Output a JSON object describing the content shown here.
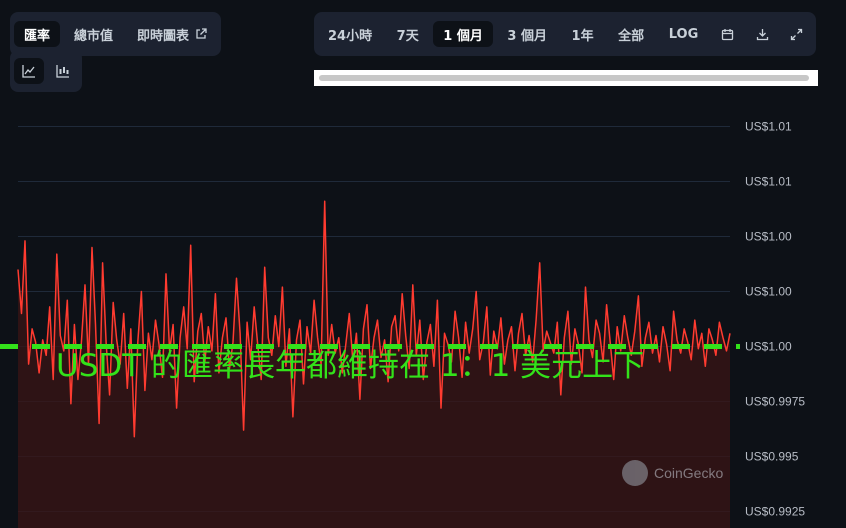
{
  "tabs": {
    "metric": [
      {
        "label": "匯率",
        "active": true
      },
      {
        "label": "總市值",
        "active": false
      },
      {
        "label": "即時圖表",
        "active": false,
        "icon": "external-link-icon"
      }
    ],
    "chart_kind": [
      {
        "icon": "line-chart-icon",
        "active": true
      },
      {
        "icon": "candlestick-chart-icon",
        "active": false
      }
    ],
    "ranges": [
      {
        "label": "24小時",
        "active": false
      },
      {
        "label": "7天",
        "active": false
      },
      {
        "label": "1 個月",
        "active": true
      },
      {
        "label": "3 個月",
        "active": false
      },
      {
        "label": "1年",
        "active": false
      },
      {
        "label": "全部",
        "active": false
      },
      {
        "label": "LOG",
        "active": false
      }
    ],
    "tool_icons": [
      "calendar-icon",
      "download-icon",
      "expand-icon"
    ]
  },
  "watermark": "CoinGecko",
  "overlay_caption": "USDT 的匯率長年都維持在 1：1 美元上下",
  "colors": {
    "background": "#0d1117",
    "line": "#ff3b30",
    "area": "#3a1416",
    "reference_line": "#33e21a",
    "grid": "#1f2a3a"
  },
  "chart_data": {
    "type": "area",
    "title": "",
    "xlabel": "",
    "ylabel": "",
    "ylim": [
      0.99175,
      1.01175
    ],
    "y_ticks": [
      1.01,
      1.0075,
      1.005,
      1.0025,
      1.0,
      0.9975,
      0.995,
      0.9925
    ],
    "y_tick_labels": [
      "US$1.01",
      "US$1.01",
      "US$1.00",
      "US$1.00",
      "US$1.00",
      "US$0.9975",
      "US$0.995",
      "US$0.9925"
    ],
    "grid": true,
    "reference_line": {
      "value": 1.0,
      "style": "dashed"
    },
    "series": [
      {
        "values": [
          1.0035,
          1.0015,
          1.0048,
          0.9992,
          1.0008,
          1.0002,
          0.9988,
          1.0003,
          0.9996,
          1.0018,
          0.9985,
          1.0042,
          1.0005,
          0.9998,
          1.0021,
          0.9974,
          1.001,
          0.9985,
          1.0002,
          1.0028,
          0.9992,
          1.0045,
          1.001,
          0.9965,
          1.0038,
          1.0002,
          0.9978,
          1.002,
          1.0003,
          0.9992,
          1.0015,
          0.9981,
          1.0008,
          0.9959,
          1.0002,
          1.0025,
          0.998,
          1.0006,
          0.9994,
          1.0012,
          1.0001,
          0.9986,
          1.0033,
          0.9998,
          1.001,
          0.9972,
          1.0004,
          1.0018,
          0.9999,
          1.0046,
          0.9984,
          1.0007,
          1.0015,
          0.9993,
          1.0009,
          0.9998,
          1.0024,
          0.9988,
          1.0004,
          1.0013,
          0.999,
          1.0002,
          1.0031,
          1.0006,
          0.9962,
          1.0011,
          0.9994,
          1.0018,
          1.0001,
          0.9985,
          1.0036,
          1.0004,
          0.9996,
          1.0014,
          1.0,
          1.0027,
          0.9991,
          1.0008,
          0.9968,
          1.0003,
          1.0012,
          0.9983,
          1.0009,
          0.9997,
          1.0021,
          1.0004,
          0.9992,
          1.0066,
          0.9996,
          1.001,
          0.9997,
          1.0004,
          0.9988,
          1.0001,
          1.0015,
          0.9993,
          1.0006,
          0.9976,
          1.0008,
          1.0019,
          0.999,
          1.0004,
          1.0012,
          0.9995,
          1.0003,
          0.9984,
          1.0009,
          1.0014,
          0.9998,
          1.0024,
          1.0005,
          0.999,
          1.0028,
          0.9996,
          1.0012,
          0.9985,
          1.0002,
          1.001,
          0.9991,
          1.0021,
          0.9972,
          1.0006,
          1.0001,
          0.9993,
          1.0016,
          1.0004,
          0.9986,
          1.0011,
          0.9997,
          1.0008,
          1.0025,
          0.9994,
          1.0002,
          1.0018,
          0.9987,
          1.0007,
          0.9999,
          1.0013,
          0.9992,
          1.0003,
          1.0009,
          0.9989,
          1.0006,
          1.0015,
          0.9996,
          1.0005,
          0.9993,
          1.0012,
          1.0038,
          0.9998,
          1.0007,
          1.0002,
          0.9997,
          1.0011,
          0.9978,
          1.0004,
          1.0016,
          0.9992,
          1.0008,
          1.0001,
          0.9988,
          1.0027,
          1.0003,
          0.9995,
          1.0012,
          1.0006,
          0.9993,
          1.0019,
          1.0002,
          0.9985,
          1.0009,
          0.9998,
          1.0014,
          1.0004,
          0.9996,
          1.0007,
          1.0023,
          0.9991,
          1.0004,
          1.0011,
          0.9997,
          1.0005,
          0.9993,
          1.0009,
          1.0001,
          0.9989,
          1.0016,
          1.0003,
          0.9997,
          1.0008,
          1.0002,
          0.9994,
          1.0012,
          0.9999,
          1.0006,
          0.9991,
          1.0008,
          1.0003,
          0.9996,
          1.0011,
          1.0004,
          0.9998,
          1.0006
        ]
      }
    ]
  }
}
